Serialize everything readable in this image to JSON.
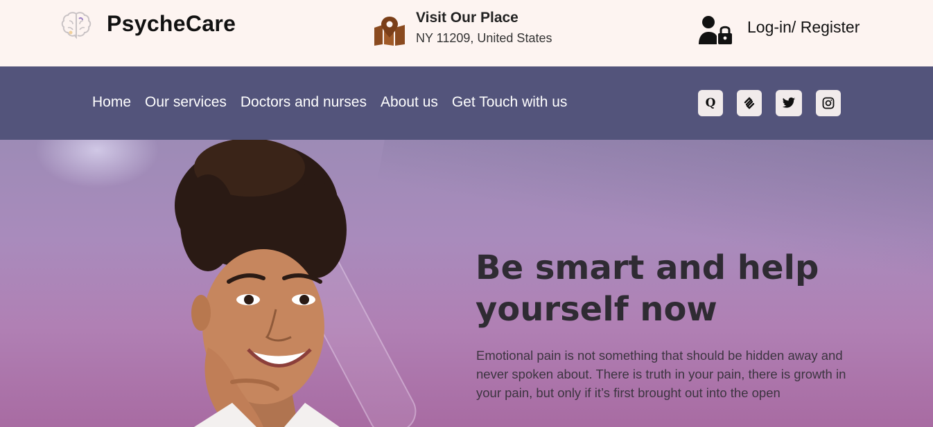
{
  "header": {
    "brand_name": "PsycheCare",
    "visit_title": "Visit Our Place",
    "visit_address": "NY 11209, United States",
    "login_label": "Log-in/ Register",
    "icons": {
      "logo": "brain-icon",
      "visit": "map-pin-icon",
      "login": "user-lock-icon"
    },
    "accent_color": "#8a4a1f"
  },
  "nav": {
    "links": [
      "Home",
      "Our services",
      "Doctors and nurses",
      "About us",
      "Get Touch with us"
    ],
    "socials": [
      "quora-icon",
      "squarespace-icon",
      "twitter-icon",
      "instagram-icon"
    ],
    "background": "#53547b"
  },
  "hero": {
    "title": "Be smart and help yourself now",
    "text": "Emotional pain is not something that should be hidden away and never spoken about. There is truth in your pain, there is growth in your pain, but only if it’s first brought out into the open"
  }
}
